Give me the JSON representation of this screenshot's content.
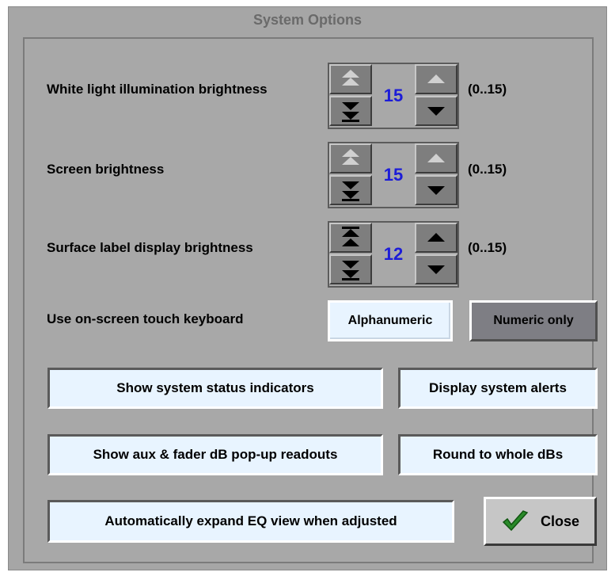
{
  "dialog": {
    "title": "System Options"
  },
  "settings": [
    {
      "label": "White light illumination brightness",
      "value": "15",
      "range": "(0..15)"
    },
    {
      "label": "Screen brightness",
      "value": "15",
      "range": "(0..15)"
    },
    {
      "label": "Surface label display brightness",
      "value": "12",
      "range": "(0..15)"
    }
  ],
  "keyboard": {
    "label": "Use on-screen touch keyboard",
    "alphanumeric_label": "Alphanumeric",
    "numeric_label": "Numeric only"
  },
  "toggles": {
    "status_indicators": "Show system status indicators",
    "system_alerts": "Display system alerts",
    "db_readouts": "Show aux & fader dB pop-up readouts",
    "round_db": "Round to whole dBs",
    "expand_eq": "Automatically expand EQ view when adjusted"
  },
  "close": {
    "label": "Close",
    "icon": "checkmark-icon",
    "icon_color": "#2a8a2a"
  },
  "colors": {
    "value_text": "#1c1cd8",
    "panel_bg": "#a8a8a8",
    "button_light": "#e8f4ff",
    "button_dark": "#7e7e84"
  }
}
